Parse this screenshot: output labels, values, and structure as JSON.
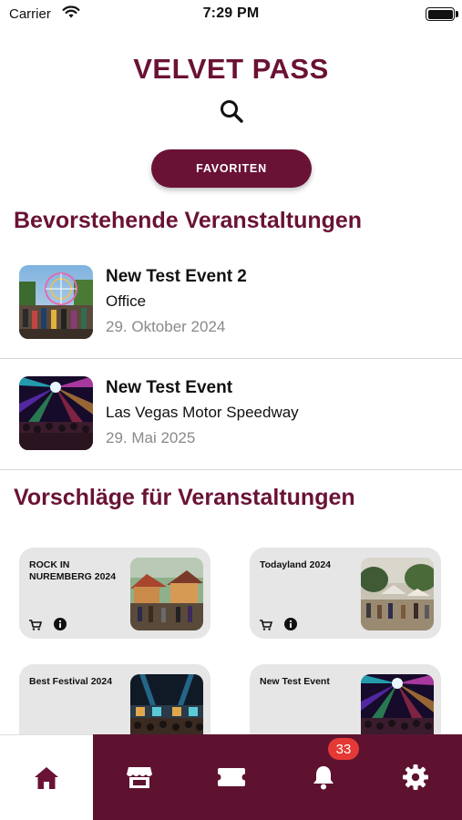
{
  "status_bar": {
    "carrier": "Carrier",
    "time": "7:29 PM",
    "icons": [
      "wifi-icon",
      "battery-icon"
    ]
  },
  "header": {
    "title": "VELVET PASS",
    "search_icon": "search-icon",
    "favorites_label": "FAVORITEN"
  },
  "colors": {
    "brand": "#6a1235",
    "tab_bar": "#5e1230",
    "badge": "#e53935"
  },
  "upcoming": {
    "title": "Bevorstehende Veranstaltungen",
    "events": [
      {
        "name": "New Test Event 2",
        "venue": "Office",
        "date": "29. Oktober 2024"
      },
      {
        "name": "New Test Event",
        "venue": "Las Vegas Motor Speedway",
        "date": "29. Mai 2025"
      }
    ]
  },
  "suggestions": {
    "title": "Vorschläge für Veranstaltungen",
    "items": [
      {
        "name": "ROCK IN NUREMBERG 2024"
      },
      {
        "name": "Todayland 2024"
      },
      {
        "name": "Best Festival 2024"
      },
      {
        "name": "New Test Event"
      }
    ]
  },
  "tab_bar": {
    "tabs": [
      "home-icon",
      "store-icon",
      "ticket-icon",
      "bell-icon",
      "gear-icon"
    ],
    "notification_count": "33"
  }
}
